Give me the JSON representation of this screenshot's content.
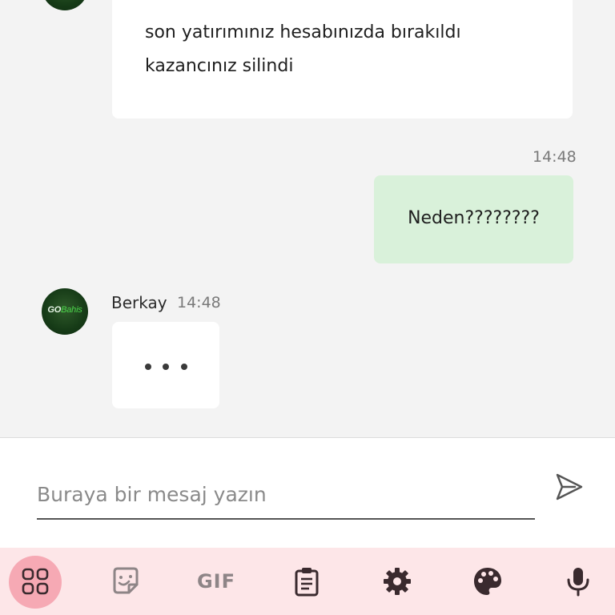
{
  "chat": {
    "messages": [
      {
        "type": "incoming",
        "text_lines": [
          "son yatırımınız hesabınızda bırakıldı",
          "kazancınız silindi"
        ]
      },
      {
        "type": "outgoing",
        "time": "14:48",
        "text": "Neden????????"
      },
      {
        "type": "incoming-typing",
        "sender": "Berkay",
        "time": "14:48",
        "avatar_logo": "GOBahis"
      }
    ]
  },
  "composer": {
    "placeholder": "Buraya bir mesaj yazın",
    "value": ""
  },
  "toolbar": {
    "items": [
      {
        "icon": "apps-grid-icon",
        "active": true
      },
      {
        "icon": "sticker-icon"
      },
      {
        "icon": "gif-icon",
        "label": "GIF"
      },
      {
        "icon": "clipboard-icon"
      },
      {
        "icon": "settings-gear-icon"
      },
      {
        "icon": "palette-icon"
      },
      {
        "icon": "microphone-icon"
      }
    ]
  },
  "colors": {
    "chat_bg": "#f3f3f3",
    "outgoing_bubble": "#d9f1da",
    "incoming_bubble": "#ffffff",
    "toolbar_bg": "#fde6e8",
    "toolbar_active": "#f6a9b4",
    "avatar_green": "#163b17",
    "logo_accent": "#4bd34b"
  }
}
